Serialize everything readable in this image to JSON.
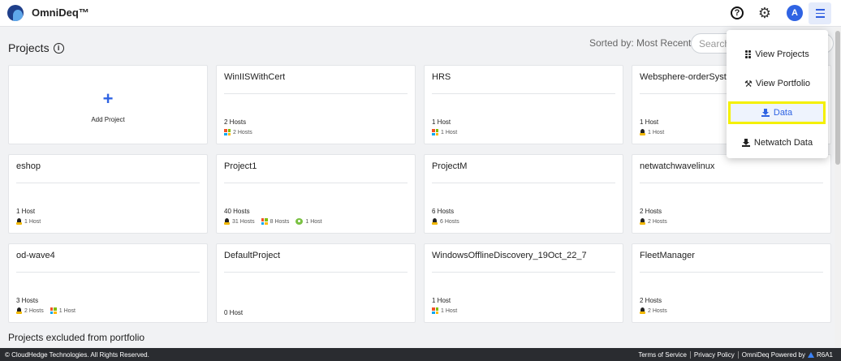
{
  "header": {
    "brand": "OmniDeq™",
    "avatar_initial": "A"
  },
  "projects": {
    "title": "Projects",
    "sorted_by": "Sorted by: Most Recent",
    "search_placeholder": "Search",
    "add_label": "Add Project",
    "add_symbol": "+",
    "cards": [
      {
        "name": "WinIISWithCert",
        "count": "2 Hosts",
        "hosts": [
          {
            "os": "windows",
            "label": "2 Hosts"
          }
        ]
      },
      {
        "name": "HRS",
        "count": "1 Host",
        "hosts": [
          {
            "os": "windows",
            "label": "1 Host"
          }
        ]
      },
      {
        "name": "Websphere-orderSystem",
        "count": "1 Host",
        "hosts": [
          {
            "os": "linux",
            "label": "1 Host"
          }
        ]
      },
      {
        "name": "eshop",
        "count": "1 Host",
        "hosts": [
          {
            "os": "linux",
            "label": "1 Host"
          }
        ]
      },
      {
        "name": "Project1",
        "count": "40 Hosts",
        "hosts": [
          {
            "os": "linux",
            "label": "31 Hosts"
          },
          {
            "os": "windows",
            "label": "8 Hosts"
          },
          {
            "os": "other",
            "label": "1 Host"
          }
        ]
      },
      {
        "name": "ProjectM",
        "count": "6 Hosts",
        "hosts": [
          {
            "os": "linux",
            "label": "6 Hosts"
          }
        ]
      },
      {
        "name": "netwatchwavelinux",
        "count": "2 Hosts",
        "hosts": [
          {
            "os": "linux",
            "label": "2 Hosts"
          }
        ]
      },
      {
        "name": "od-wave4",
        "count": "3 Hosts",
        "hosts": [
          {
            "os": "linux",
            "label": "2 Hosts"
          },
          {
            "os": "windows",
            "label": "1 Host"
          }
        ]
      },
      {
        "name": "DefaultProject",
        "count": "0 Host",
        "hosts": []
      },
      {
        "name": "WindowsOfflineDiscovery_19Oct_22_7",
        "count": "1 Host",
        "hosts": [
          {
            "os": "windows",
            "label": "1 Host"
          }
        ]
      },
      {
        "name": "FleetManager",
        "count": "2 Hosts",
        "hosts": [
          {
            "os": "linux",
            "label": "2 Hosts"
          }
        ]
      }
    ]
  },
  "excluded_title": "Projects excluded from portfolio",
  "menu": {
    "view_projects": "View Projects",
    "view_portfolio": "View Portfolio",
    "data": "Data",
    "netwatch_data": "Netwatch Data"
  },
  "footer": {
    "copyright": "© CloudHedge Technologies. All Rights Reserved.",
    "terms": "Terms of Service",
    "privacy": "Privacy Policy",
    "powered": "OmniDeq Powered by",
    "version": "R6A1"
  },
  "colors": {
    "accent": "#2f63e3",
    "highlight": "#f4f000",
    "footer_bg": "#2a2c30"
  }
}
